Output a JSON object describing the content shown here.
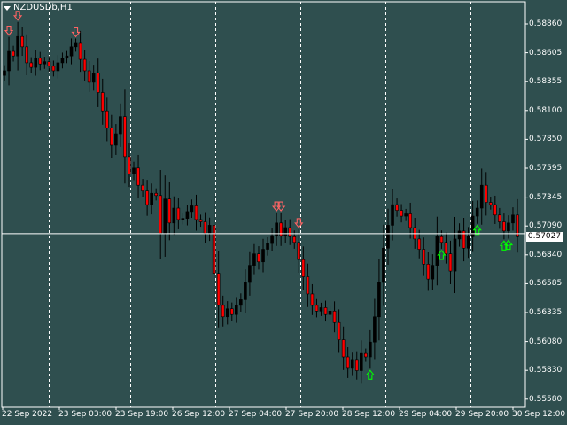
{
  "window": {
    "title": "NZDUSDb,H1",
    "symbol": "NZDUSDb",
    "timeframe": "H1"
  },
  "colors": {
    "background": "#2f4f4f",
    "foreground": "#ffffff",
    "bull_candle": "#000000",
    "bear_candle": "#ff0000",
    "sell_arrow": "#ff6464",
    "buy_arrow": "#00ff00"
  },
  "price_axis": {
    "labels": [
      "0.58860",
      "0.58605",
      "0.58355",
      "0.58100",
      "0.57850",
      "0.57595",
      "0.57345",
      "0.57090",
      "0.56840",
      "0.56585",
      "0.56335",
      "0.56080",
      "0.55830",
      "0.55580"
    ],
    "current_price": "0.57027"
  },
  "time_axis": {
    "labels": [
      "22 Sep 2022",
      "23 Sep 03:00",
      "23 Sep 19:00",
      "26 Sep 12:00",
      "27 Sep 04:00",
      "27 Sep 20:00",
      "28 Sep 12:00",
      "29 Sep 04:00",
      "29 Sep 20:00",
      "30 Sep 12:00"
    ]
  },
  "chart_data": {
    "type": "candlestick",
    "ylim": [
      0.5555,
      0.5905
    ],
    "closes": [
      0.5845,
      0.5862,
      0.5858,
      0.5875,
      0.5866,
      0.5852,
      0.5848,
      0.5856,
      0.5851,
      0.5853,
      0.5849,
      0.5845,
      0.5852,
      0.5856,
      0.5858,
      0.5866,
      0.5869,
      0.5855,
      0.5845,
      0.5835,
      0.5843,
      0.5826,
      0.581,
      0.5795,
      0.578,
      0.579,
      0.5805,
      0.577,
      0.5755,
      0.576,
      0.5745,
      0.574,
      0.5728,
      0.5738,
      0.5736,
      0.5703,
      0.5733,
      0.5712,
      0.5725,
      0.5715,
      0.5716,
      0.5722,
      0.5727,
      0.5715,
      0.5713,
      0.5703,
      0.571,
      0.5668,
      0.564,
      0.563,
      0.5637,
      0.5632,
      0.564,
      0.5645,
      0.566,
      0.5675,
      0.5685,
      0.5678,
      0.5689,
      0.5694,
      0.5701,
      0.5712,
      0.5701,
      0.5708,
      0.57,
      0.5695,
      0.568,
      0.5665,
      0.565,
      0.564,
      0.5635,
      0.5638,
      0.5632,
      0.5635,
      0.5625,
      0.561,
      0.5595,
      0.5585,
      0.5592,
      0.5583,
      0.5598,
      0.5595,
      0.5608,
      0.563,
      0.566,
      0.569,
      0.571,
      0.5728,
      0.5723,
      0.5718,
      0.572,
      0.5708,
      0.5698,
      0.5689,
      0.5676,
      0.5663,
      0.5675,
      0.57,
      0.5695,
      0.5685,
      0.567,
      0.5698,
      0.5705,
      0.569,
      0.57,
      0.5718,
      0.5725,
      0.5745,
      0.573,
      0.5728,
      0.5719,
      0.5713,
      0.5705,
      0.5712,
      0.5719,
      0.57
    ],
    "sell_signal_bars": [
      1,
      3,
      16,
      61,
      62,
      66
    ],
    "buy_signal_bars": [
      82,
      98,
      106,
      112,
      113
    ],
    "current_price_line": 0.57027,
    "grid": "vertical-dashed"
  }
}
